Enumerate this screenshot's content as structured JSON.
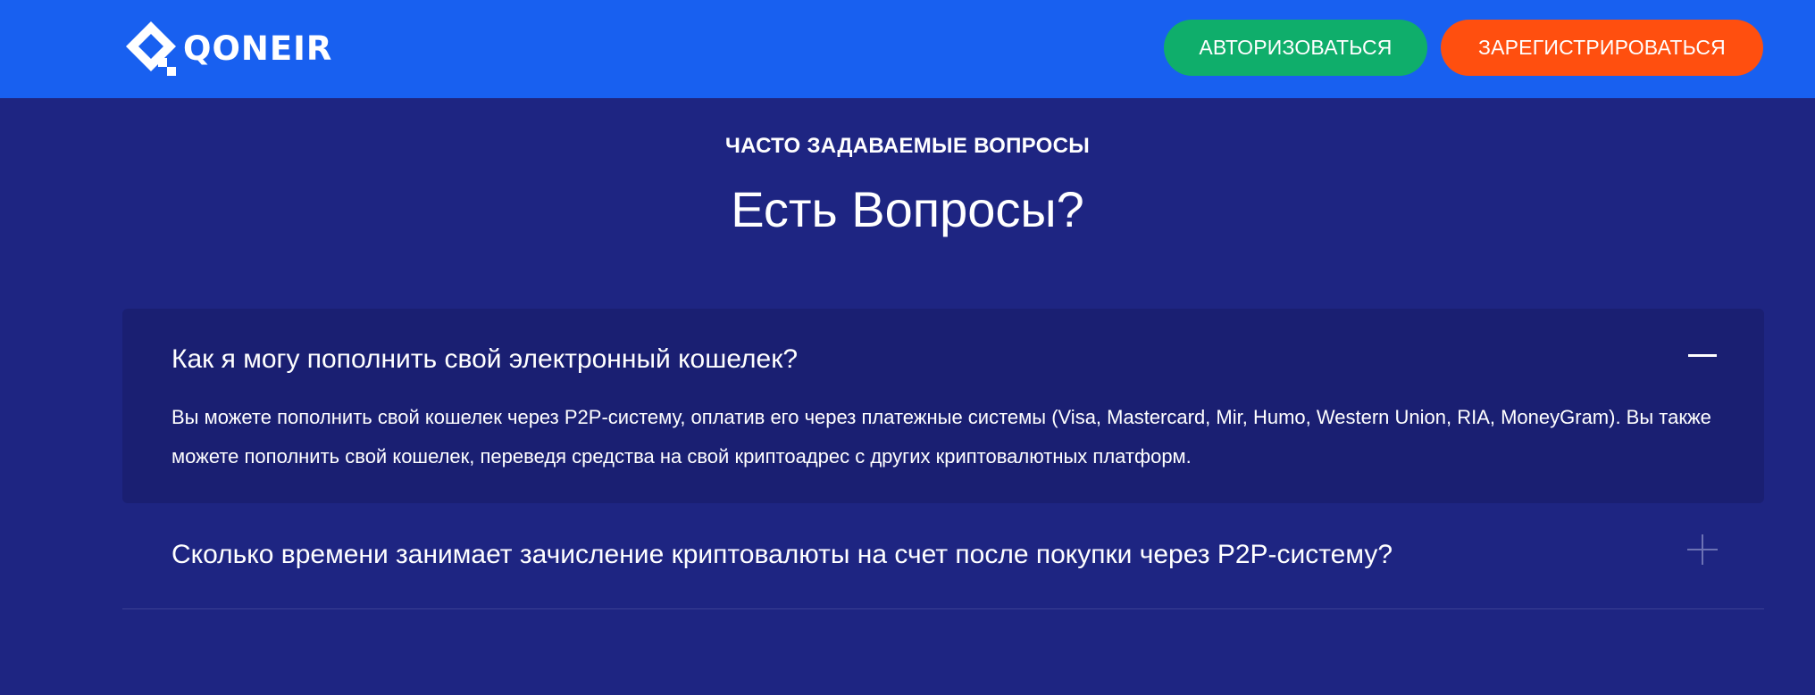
{
  "header": {
    "brand": "QONEIR",
    "login_label": "АВТОРИЗОВАТЬСЯ",
    "register_label": "ЗАРЕГИСТРИРОВАТЬСЯ"
  },
  "faq": {
    "eyebrow": "ЧАСТО ЗАДАВАЕМЫЕ ВОПРОСЫ",
    "title": "Есть Вопросы?",
    "items": [
      {
        "question": "Как я могу пополнить свой электронный кошелек?",
        "answer": "Вы можете пополнить свой кошелек через P2P-систему, оплатив его через платежные системы (Visa, Mastercard, Mir, Humo, Western Union, RIA, MoneyGram). Вы также можете пополнить свой кошелек, переведя средства на свой криптоадрес с других криптовалютных платформ.",
        "expanded": true
      },
      {
        "question": "Сколько времени занимает зачисление криптовалюты на счет после покупки через P2P-систему?",
        "expanded": false
      }
    ]
  },
  "colors": {
    "header_bg": "#1860f0",
    "page_bg": "#1e2582",
    "open_item_bg": "#1a1f72",
    "login_button": "#0fae6b",
    "register_button": "#ff4f0f"
  },
  "icons": {
    "logo": "qoneir-logo-icon",
    "collapse": "minus-icon",
    "expand": "plus-icon"
  }
}
